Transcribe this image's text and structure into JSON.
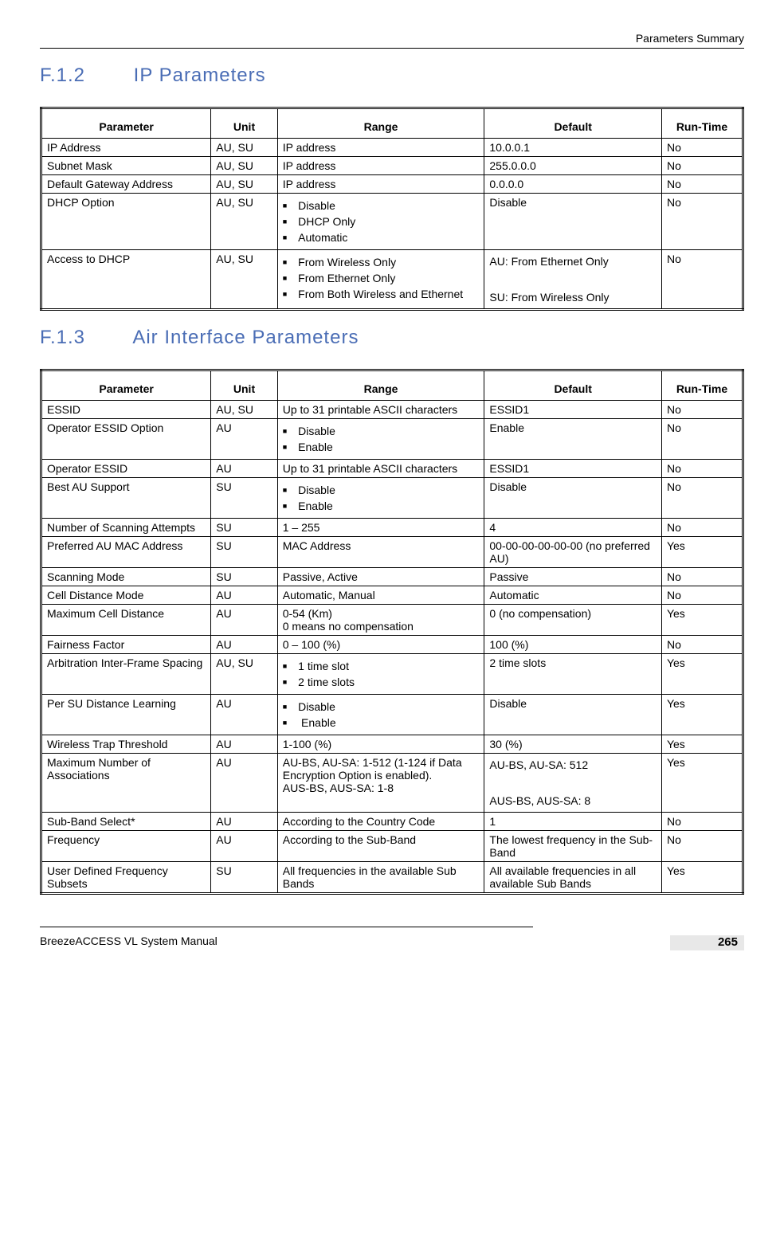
{
  "header": {
    "right": "Parameters Summary"
  },
  "sections": {
    "ip": {
      "num": "F.1.2",
      "title": "IP Parameters"
    },
    "air": {
      "num": "F.1.3",
      "title": "Air Interface Parameters"
    }
  },
  "columns": {
    "param": "Parameter",
    "unit": "Unit",
    "range": "Range",
    "default": "Default",
    "runtime": "Run-Time"
  },
  "ip_rows": [
    {
      "param": "IP Address",
      "unit": "AU, SU",
      "range": "IP address",
      "default": "10.0.0.1",
      "runtime": "No"
    },
    {
      "param": "Subnet Mask",
      "unit": "AU, SU",
      "range": "IP address",
      "default": "255.0.0.0",
      "runtime": "No"
    },
    {
      "param": "Default Gateway Address",
      "unit": "AU, SU",
      "range": "IP address",
      "default": "0.0.0.0",
      "runtime": "No"
    },
    {
      "param": "DHCP Option",
      "unit": "AU, SU",
      "range_list": [
        "Disable",
        "DHCP Only",
        "Automatic"
      ],
      "default": "Disable",
      "runtime": "No"
    },
    {
      "param": "Access to DHCP",
      "unit": "AU, SU",
      "range_list": [
        "From Wireless Only",
        "From Ethernet Only",
        "From Both Wireless and Ethernet"
      ],
      "default_lines": [
        "AU: From Ethernet Only",
        "SU: From Wireless Only"
      ],
      "runtime": "No"
    }
  ],
  "air_rows": [
    {
      "param": "ESSID",
      "unit": "AU, SU",
      "range": "Up to 31 printable ASCII characters",
      "default": "ESSID1",
      "runtime": "No"
    },
    {
      "param": "Operator ESSID Option",
      "unit": "AU",
      "range_list": [
        "Disable",
        "Enable"
      ],
      "default": "Enable",
      "runtime": "No"
    },
    {
      "param": "Operator ESSID",
      "unit": "AU",
      "range": "Up to 31 printable ASCII characters",
      "default": "ESSID1",
      "runtime": "No"
    },
    {
      "param": "Best AU Support",
      "unit": "SU",
      "range_list": [
        "Disable",
        "Enable"
      ],
      "default": "Disable",
      "runtime": "No"
    },
    {
      "param": "Number of Scanning Attempts",
      "unit": "SU",
      "range": "1 – 255",
      "default": "4",
      "runtime": "No"
    },
    {
      "param": "Preferred AU MAC Address",
      "unit": "SU",
      "range": "MAC Address",
      "default": "00-00-00-00-00-00 (no preferred AU)",
      "runtime": "Yes"
    },
    {
      "param": "Scanning Mode",
      "unit": "SU",
      "range": "Passive, Active",
      "default": "Passive",
      "runtime": "No"
    },
    {
      "param": "Cell Distance Mode",
      "unit": "AU",
      "range": "Automatic, Manual",
      "default": "Automatic",
      "runtime": "No"
    },
    {
      "param": "Maximum Cell Distance",
      "unit": "AU",
      "range": "0-54 (Km)\n0 means no compensation",
      "default": "0 (no compensation)",
      "runtime": "Yes"
    },
    {
      "param": "Fairness Factor",
      "unit": "AU",
      "range": "0 – 100 (%)",
      "default": "100 (%)",
      "runtime": "No"
    },
    {
      "param": "Arbitration Inter-Frame Spacing",
      "unit": "AU, SU",
      "range_list": [
        "1 time slot",
        "2 time slots"
      ],
      "default": "2 time slots",
      "runtime": "Yes"
    },
    {
      "param": "Per SU Distance Learning",
      "unit": "AU",
      "range_list": [
        "Disable",
        " Enable"
      ],
      "default": "Disable",
      "runtime": "Yes"
    },
    {
      "param": "Wireless Trap Threshold",
      "unit": "AU",
      "range": "1-100 (%)",
      "default": "30 (%)",
      "runtime": "Yes"
    },
    {
      "param": "Maximum Number of Associations",
      "unit": "AU",
      "range": "AU-BS, AU-SA: 1-512 (1-124 if Data Encryption Option is enabled).\nAUS-BS, AUS-SA: 1-8",
      "default_lines": [
        "AU-BS, AU-SA: 512",
        "AUS-BS, AUS-SA:  8"
      ],
      "runtime": "Yes"
    },
    {
      "param": "Sub-Band Select*",
      "unit": "AU",
      "range": "According to the Country Code",
      "default": "1",
      "runtime": "No"
    },
    {
      "param": "Frequency",
      "unit": "AU",
      "range": "According to the Sub-Band",
      "default": "The lowest frequency in the Sub-Band",
      "runtime": "No"
    },
    {
      "param": "User Defined Frequency Subsets",
      "unit": "SU",
      "range": "All frequencies in the available Sub Bands",
      "default": "All available frequencies in all available Sub Bands",
      "runtime": "Yes"
    }
  ],
  "footer": {
    "left": "BreezeACCESS VL System Manual",
    "page": "265"
  }
}
